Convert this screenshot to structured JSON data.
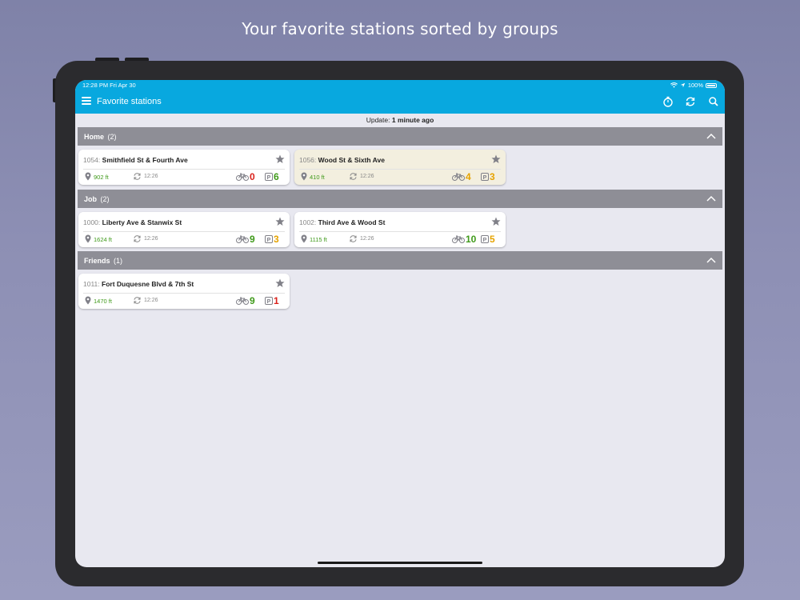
{
  "caption": "Your favorite stations sorted by groups",
  "status": {
    "time": "12:28 PM   Fri Apr 30",
    "battery": "100%"
  },
  "appbar": {
    "title": "Favorite stations"
  },
  "update": {
    "label": "Update:",
    "value": "1 minute ago"
  },
  "colors": {
    "accent": "#08a8df",
    "group_header": "#8e8e96",
    "distance_green": "#3f9a1a",
    "count_green": "#3f9a1a",
    "count_red": "#d9211b",
    "count_orange": "#e6a300",
    "highlight_card": "#f3efdf"
  },
  "groups": [
    {
      "name": "Home",
      "count": "(2)",
      "stations": [
        {
          "id": "1054:",
          "name": "Smithfield St & Fourth Ave",
          "distance": "902 ft",
          "time": "12:26",
          "bikes": "0",
          "bikes_color": "red",
          "docks": "6",
          "docks_color": "green",
          "highlighted": false
        },
        {
          "id": "1056:",
          "name": "Wood St & Sixth Ave",
          "distance": "410 ft",
          "time": "12:26",
          "bikes": "4",
          "bikes_color": "orange",
          "docks": "3",
          "docks_color": "orange",
          "highlighted": true
        }
      ]
    },
    {
      "name": "Job",
      "count": "(2)",
      "stations": [
        {
          "id": "1000:",
          "name": "Liberty Ave & Stanwix St",
          "distance": "1624 ft",
          "time": "12:26",
          "bikes": "9",
          "bikes_color": "green",
          "docks": "3",
          "docks_color": "orange",
          "highlighted": false
        },
        {
          "id": "1002:",
          "name": "Third Ave & Wood St",
          "distance": "1115 ft",
          "time": "12:26",
          "bikes": "10",
          "bikes_color": "green",
          "docks": "5",
          "docks_color": "orange",
          "highlighted": false
        }
      ]
    },
    {
      "name": "Friends",
      "count": "(1)",
      "stations": [
        {
          "id": "1011:",
          "name": "Fort Duquesne Blvd & 7th St",
          "distance": "1470 ft",
          "time": "12:26",
          "bikes": "9",
          "bikes_color": "green",
          "docks": "1",
          "docks_color": "red",
          "highlighted": false
        }
      ]
    }
  ]
}
